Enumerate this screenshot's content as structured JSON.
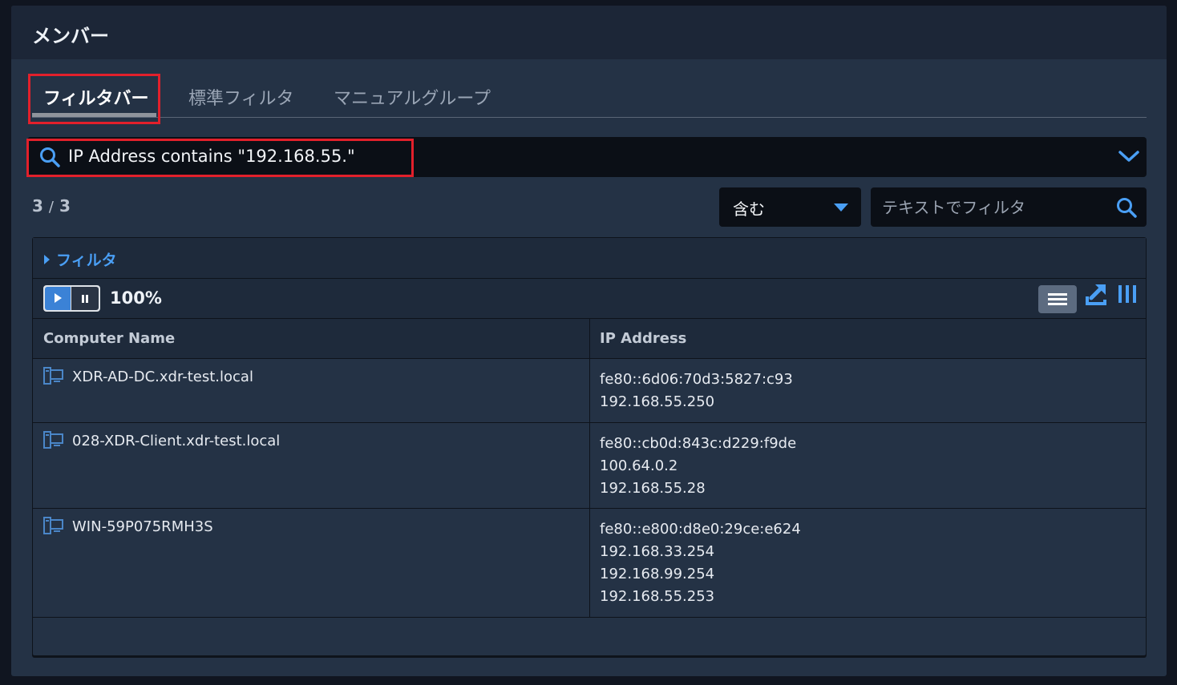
{
  "panel": {
    "title": "メンバー"
  },
  "tabs": [
    {
      "label": "フィルタバー",
      "active": true
    },
    {
      "label": "標準フィルタ",
      "active": false
    },
    {
      "label": "マニュアルグループ",
      "active": false
    }
  ],
  "query": {
    "text": "IP Address contains \"192.168.55.\"",
    "icon": "search-icon",
    "expand_icon": "chevron-down-icon"
  },
  "count": {
    "shown": "3",
    "separator": "/",
    "total": "3"
  },
  "filter_controls": {
    "operator_selected": "含む",
    "text_filter_placeholder": "テキストでフィルタ"
  },
  "grid": {
    "filter_toggle_label": "フィルタ",
    "refresh_percent": "100%",
    "columns": [
      "Computer Name",
      "IP Address"
    ],
    "rows": [
      {
        "name": "XDR-AD-DC.xdr-test.local",
        "ips": [
          "fe80::6d06:70d3:5827:c93",
          "192.168.55.250"
        ]
      },
      {
        "name": "028-XDR-Client.xdr-test.local",
        "ips": [
          "fe80::cb0d:843c:d229:f9de",
          "100.64.0.2",
          "192.168.55.28"
        ]
      },
      {
        "name": "WIN-59P075RMH3S",
        "ips": [
          "fe80::e800:d8e0:29ce:e624",
          "192.168.33.254",
          "192.168.99.254",
          "192.168.55.253"
        ]
      }
    ]
  },
  "colors": {
    "accent": "#4a9ff5",
    "highlight": "#e2202b",
    "panel_bg": "#243245"
  }
}
